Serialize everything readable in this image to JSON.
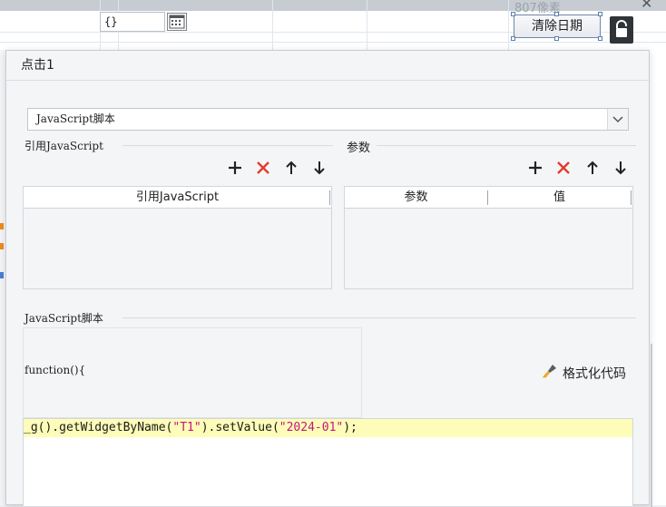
{
  "background": {
    "date_input_value": "{}",
    "size_label": "807像素",
    "clear_button_label": "清除日期"
  },
  "dialog": {
    "title": "点击1",
    "type_select_value": "JavaScript脚本",
    "ref_group_label": "引用JavaScript",
    "params_group_label": "参数",
    "ref_table": {
      "columns": [
        "引用JavaScript"
      ]
    },
    "params_table": {
      "columns": [
        "参数",
        "值"
      ]
    },
    "script_group_label": "JavaScript脚本",
    "function_header": "function(){",
    "format_button_label": "格式化代码",
    "code": {
      "prefix": "_g().getWidgetByName(",
      "arg1": "\"T1\"",
      "middle": ").setValue(",
      "arg2": "\"2024-01\"",
      "suffix": ");"
    }
  },
  "colors": {
    "add": "#222222",
    "delete": "#e23b2e",
    "highlight": "#fdfcb8",
    "string": "#c2187a"
  },
  "icons": [
    "plus-icon",
    "delete-x-icon",
    "arrow-up-icon",
    "arrow-down-icon",
    "chevron-down-icon",
    "lock-icon",
    "calendar-icon",
    "brush-icon",
    "close-icon"
  ]
}
